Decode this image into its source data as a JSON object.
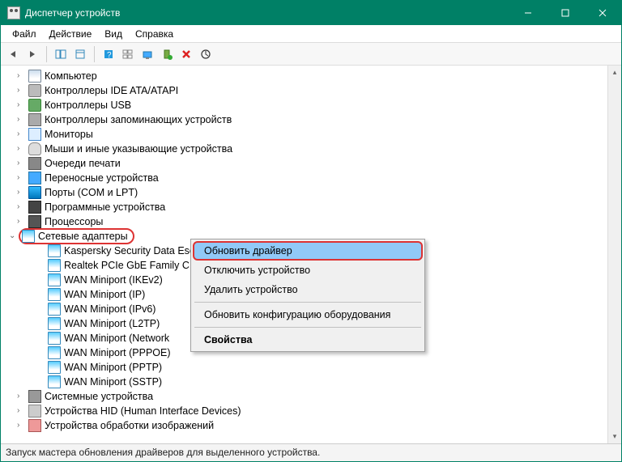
{
  "window": {
    "title": "Диспетчер устройств"
  },
  "menu": {
    "file": "Файл",
    "action": "Действие",
    "view": "Вид",
    "help": "Справка"
  },
  "tree": {
    "items": [
      {
        "label": "Компьютер",
        "icon": "computer"
      },
      {
        "label": "Контроллеры IDE ATA/ATAPI",
        "icon": "drive"
      },
      {
        "label": "Контроллеры USB",
        "icon": "usb"
      },
      {
        "label": "Контроллеры запоминающих устройств",
        "icon": "storage"
      },
      {
        "label": "Мониторы",
        "icon": "monitor"
      },
      {
        "label": "Мыши и иные указывающие устройства",
        "icon": "mouse"
      },
      {
        "label": "Очереди печати",
        "icon": "printer"
      },
      {
        "label": "Переносные устройства",
        "icon": "laptop"
      },
      {
        "label": "Порты (COM и LPT)",
        "icon": "port"
      },
      {
        "label": "Программные устройства",
        "icon": "prog"
      },
      {
        "label": "Процессоры",
        "icon": "cpu"
      },
      {
        "label": "Сетевые адаптеры",
        "icon": "net",
        "expanded": true,
        "highlight": true
      },
      {
        "label": "Системные устройства",
        "icon": "sys"
      },
      {
        "label": "Устройства HID (Human Interface Devices)",
        "icon": "hid"
      },
      {
        "label": "Устройства обработки изображений",
        "icon": "img"
      }
    ],
    "network_children": [
      "Kaspersky Security Data Escort Adapter",
      "Realtek PCIe GbE Family C",
      "WAN Miniport (IKEv2)",
      "WAN Miniport (IP)",
      "WAN Miniport (IPv6)",
      "WAN Miniport (L2TP)",
      "WAN Miniport (Network",
      "WAN Miniport (PPPOE)",
      "WAN Miniport (PPTP)",
      "WAN Miniport (SSTP)"
    ]
  },
  "context_menu": {
    "update_driver": "Обновить драйвер",
    "disable": "Отключить устройство",
    "uninstall": "Удалить устройство",
    "scan": "Обновить конфигурацию оборудования",
    "properties": "Свойства"
  },
  "status": {
    "text": "Запуск мастера обновления драйверов для выделенного устройства."
  }
}
